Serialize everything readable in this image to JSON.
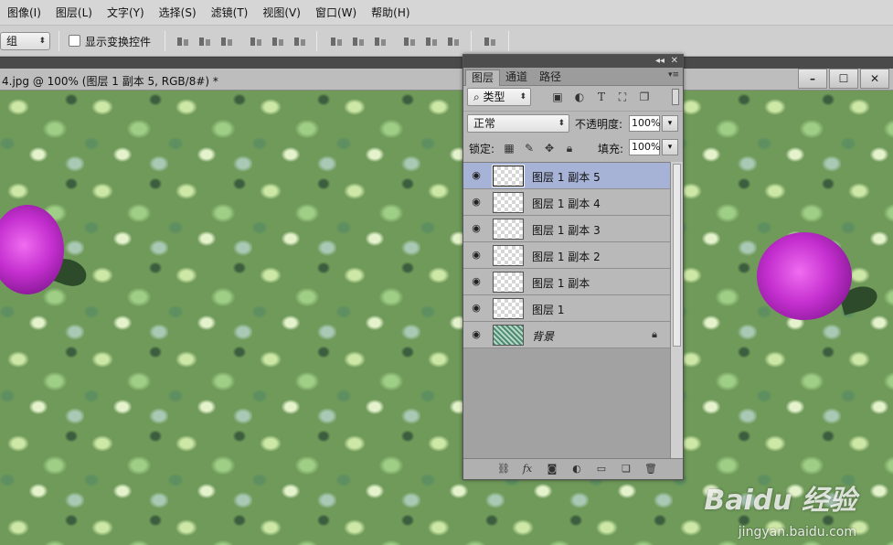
{
  "menu": [
    "图像(I)",
    "图层(L)",
    "文字(Y)",
    "选择(S)",
    "滤镜(T)",
    "视图(V)",
    "窗口(W)",
    "帮助(H)"
  ],
  "options": {
    "auto_select_value": "组",
    "show_transform_label": "显示变换控件"
  },
  "document": {
    "tab_title": "4.jpg @ 100% (图层 1 副本 5, RGB/8#) *"
  },
  "window_buttons": [
    "–",
    "☐",
    "✕"
  ],
  "panel": {
    "collapse_glyph": "◂◂",
    "close_glyph": "✕",
    "tabs": [
      "图层",
      "通道",
      "路径"
    ],
    "menu_glyph": "▾≡",
    "filter_type": "类型",
    "blend_mode": "正常",
    "opacity_label": "不透明度:",
    "opacity_value": "100%",
    "lock_label": "锁定:",
    "fill_label": "填充:",
    "fill_value": "100%",
    "layers": [
      {
        "name": "图层 1 副本 5",
        "selected": true
      },
      {
        "name": "图层 1 副本 4",
        "selected": false
      },
      {
        "name": "图层 1 副本 3",
        "selected": false
      },
      {
        "name": "图层 1 副本 2",
        "selected": false
      },
      {
        "name": "图层 1 副本",
        "selected": false
      },
      {
        "name": "图层 1",
        "selected": false
      },
      {
        "name": "背景",
        "selected": false,
        "locked": true
      }
    ]
  },
  "watermark": {
    "brand": "Baidu 经验",
    "url": "jingyan.baidu.com"
  },
  "icons": {
    "filter": "search-icon",
    "image_filter": "image-icon",
    "adjust_filter": "circle-half-icon",
    "type_filter": "text-icon",
    "shape_filter": "shape-icon",
    "smart_filter": "smart-object-icon",
    "lock_transparent": "checker-icon",
    "lock_paint": "brush-icon",
    "lock_move": "move-icon",
    "lock_all": "lock-icon",
    "link": "link-icon",
    "fx": "fx-icon",
    "mask": "mask-icon",
    "adjust": "adjustment-icon",
    "group": "folder-icon",
    "new": "new-layer-icon",
    "delete": "trash-icon"
  }
}
